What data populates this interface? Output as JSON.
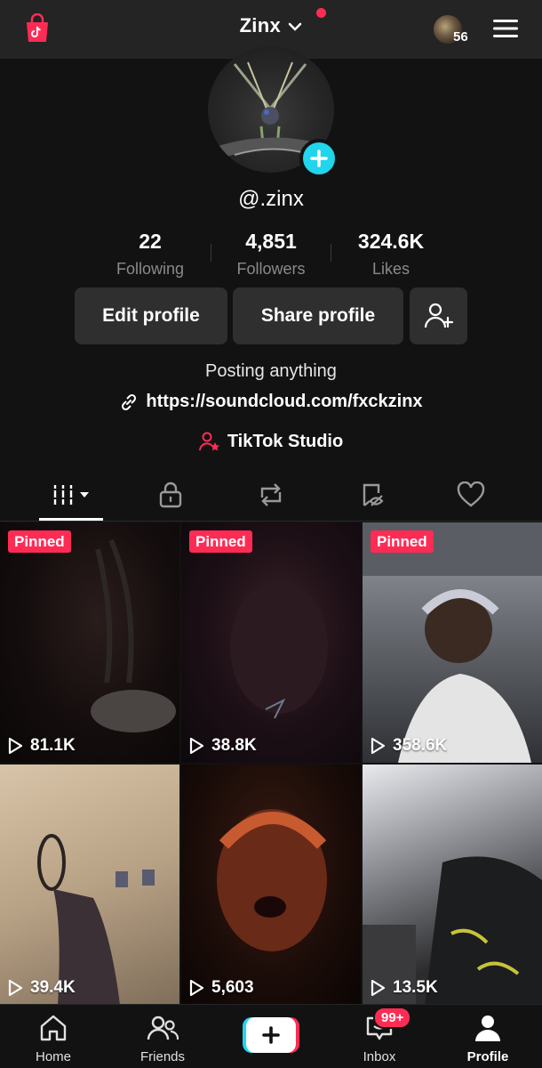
{
  "header": {
    "title": "Zinx",
    "story_count": "56",
    "shop_icon": "shop-bag-icon",
    "menu_icon": "hamburger-menu-icon"
  },
  "profile": {
    "handle": "@.zinx",
    "stats": [
      {
        "value": "22",
        "label": "Following"
      },
      {
        "value": "4,851",
        "label": "Followers"
      },
      {
        "value": "324.6K",
        "label": "Likes"
      }
    ],
    "buttons": {
      "edit": "Edit profile",
      "share": "Share profile"
    },
    "bio": "Posting anything",
    "link": "https://soundcloud.com/fxckzinx",
    "studio": "TikTok Studio"
  },
  "tabs": [
    {
      "icon": "videos-grid-icon",
      "active": true
    },
    {
      "icon": "lock-icon",
      "active": false
    },
    {
      "icon": "repost-icon",
      "active": false
    },
    {
      "icon": "bookmark-hidden-icon",
      "active": false
    },
    {
      "icon": "heart-icon",
      "active": false
    }
  ],
  "videos": [
    {
      "pinned_label": "Pinned",
      "views": "81.1K"
    },
    {
      "pinned_label": "Pinned",
      "views": "38.8K"
    },
    {
      "pinned_label": "Pinned",
      "views": "358.6K"
    },
    {
      "pinned_label": "",
      "views": "39.4K"
    },
    {
      "pinned_label": "",
      "views": "5,603"
    },
    {
      "pinned_label": "",
      "views": "13.5K"
    }
  ],
  "bottom_nav": {
    "home": "Home",
    "friends": "Friends",
    "inbox": "Inbox",
    "inbox_badge": "99+",
    "profile": "Profile"
  },
  "colors": {
    "accent_red": "#fe2c55",
    "accent_cyan": "#20d5ec",
    "background": "#121212"
  }
}
